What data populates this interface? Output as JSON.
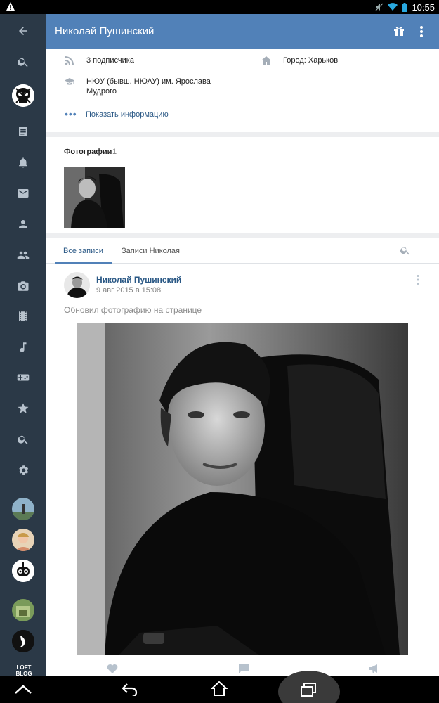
{
  "status_bar": {
    "time": "10:55"
  },
  "sidebar": {
    "items": [
      {
        "name": "back-icon"
      },
      {
        "name": "search-icon"
      },
      {
        "name": "profile-avatar"
      },
      {
        "name": "news-icon"
      },
      {
        "name": "notifications-icon"
      },
      {
        "name": "messages-icon"
      },
      {
        "name": "friends-icon"
      },
      {
        "name": "groups-icon"
      },
      {
        "name": "camera-icon"
      },
      {
        "name": "video-icon"
      },
      {
        "name": "music-icon"
      },
      {
        "name": "games-icon"
      },
      {
        "name": "favorites-icon"
      },
      {
        "name": "search-people-icon"
      },
      {
        "name": "settings-icon"
      }
    ],
    "loft_label": "LOFT BLOG"
  },
  "header": {
    "title": "Николай Пушинский"
  },
  "info": {
    "followers": "3 подписчика",
    "city": "Город: Харьков",
    "university_line1": "НЮУ (бывш. НЮАУ) им. Ярослава",
    "university_line2": "Мудрого",
    "show_more": "Показать информацию"
  },
  "photos": {
    "title": "Фотографии",
    "count": "1"
  },
  "tabs": {
    "all_posts": "Все записи",
    "user_posts": "Записи Николая"
  },
  "post": {
    "author": "Николай Пушинский",
    "date": "9 авг 2015 в 15:08",
    "text": "Обновил фотографию на странице"
  },
  "colors": {
    "header": "#5181b8",
    "sidebar": "#2b3947",
    "link": "#2a5885"
  }
}
